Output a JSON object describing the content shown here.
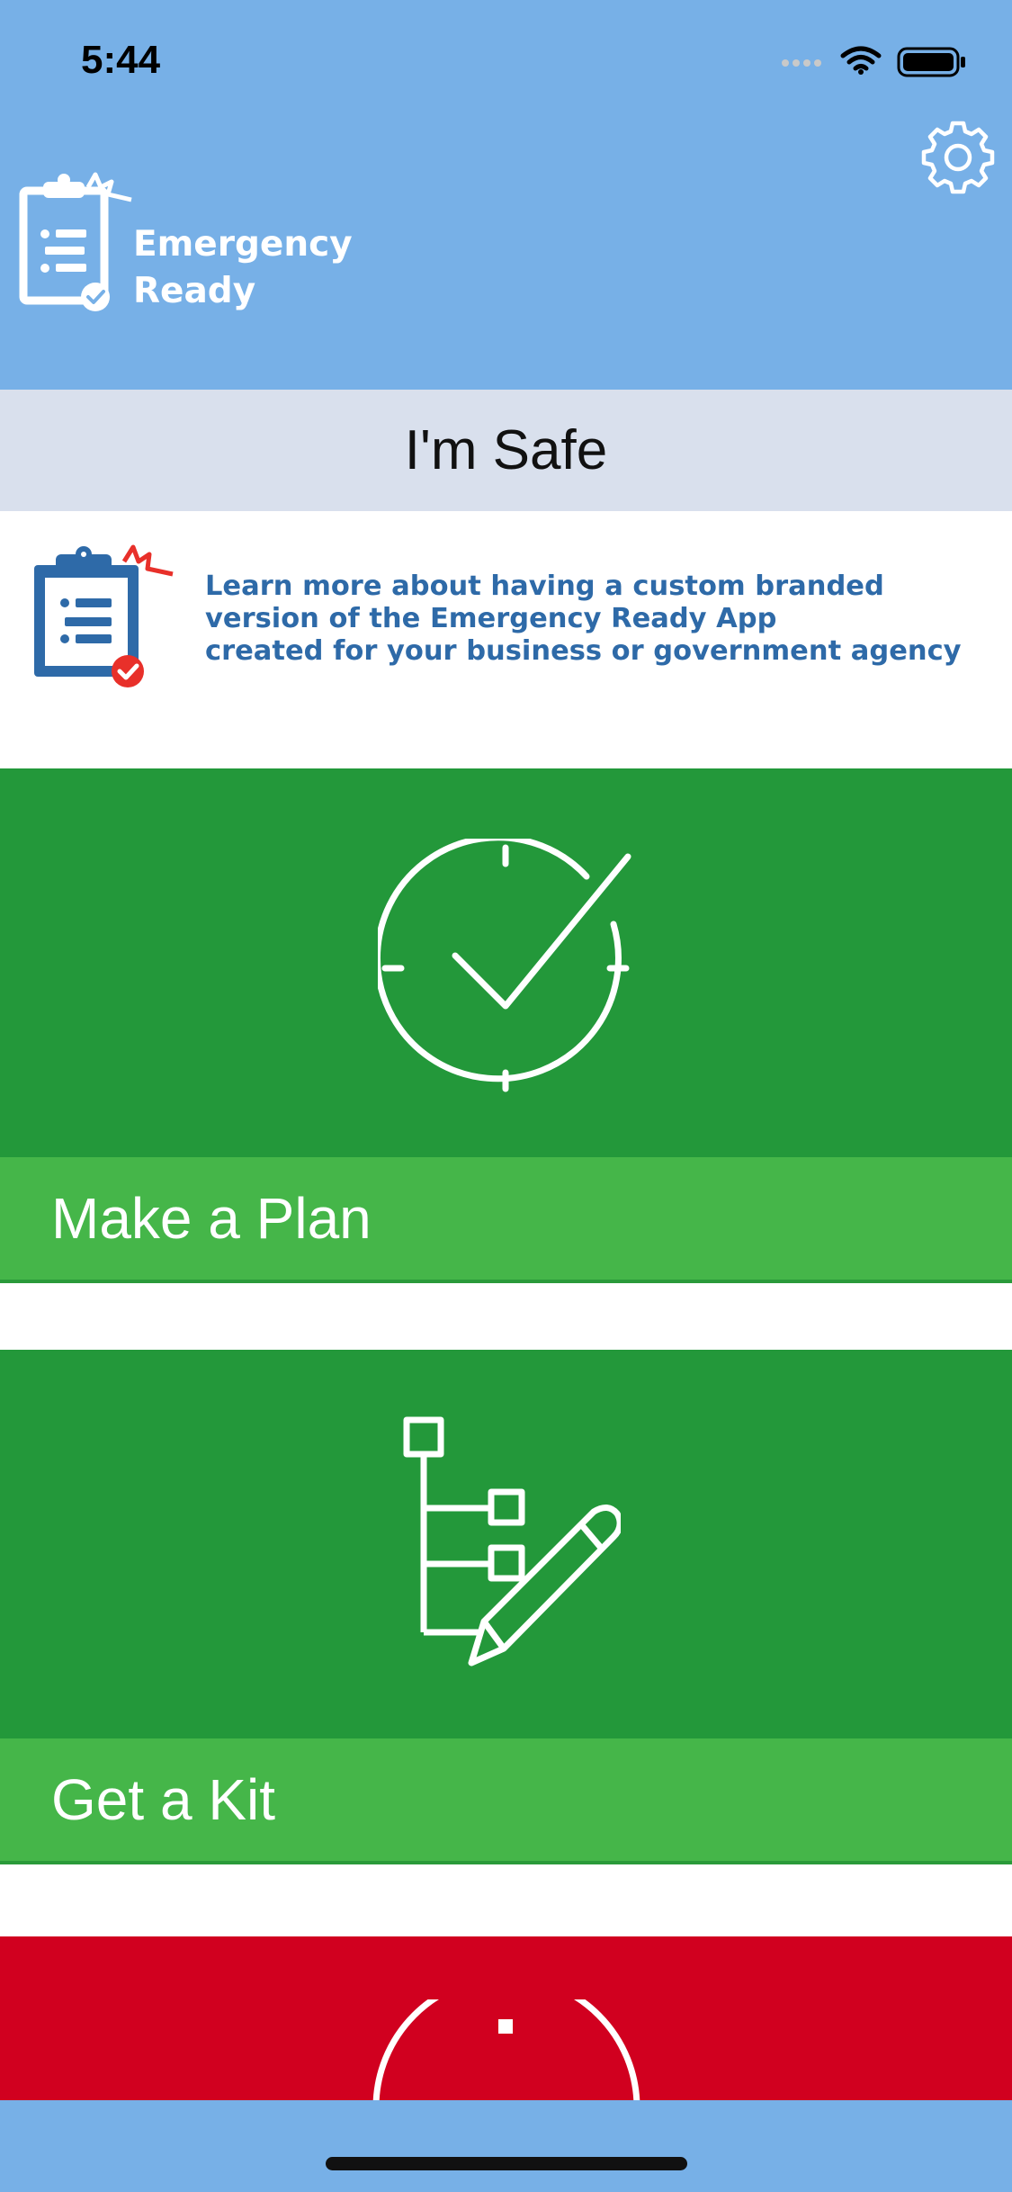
{
  "status_bar": {
    "time": "5:44"
  },
  "header": {
    "app_name_line1": "Emergency",
    "app_name_line2": "Ready",
    "settings_icon": "gear-icon"
  },
  "safe_button": {
    "label": "I'm Safe"
  },
  "promo": {
    "line1": "Learn more about having a custom branded",
    "line2": "version of the Emergency Ready App",
    "line3": "created for your business or government agency"
  },
  "tiles": [
    {
      "label": "Make a Plan",
      "icon": "clock-check-icon",
      "color": "#23983a"
    },
    {
      "label": "Get a Kit",
      "icon": "checklist-pencil-icon",
      "color": "#23983a"
    },
    {
      "label": "",
      "icon": "alarm-clock-icon",
      "color": "#d1001f"
    }
  ],
  "colors": {
    "header": "#77b0e7",
    "safe_bar": "#d9e0ed",
    "tile_label": "#45b649",
    "promo_text": "#2e6aa8"
  }
}
